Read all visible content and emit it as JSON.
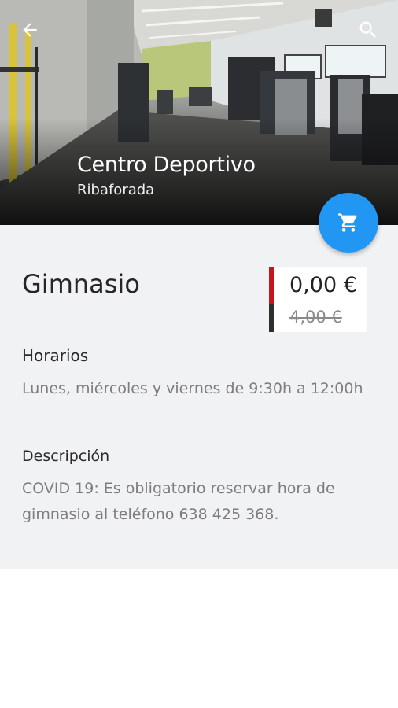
{
  "header": {
    "venue_name": "Centro Deportivo",
    "venue_location": "Ribaforada",
    "back_icon": "arrow-back-icon",
    "search_icon": "search-icon"
  },
  "fab": {
    "icon": "cart-icon",
    "color": "#2196f3"
  },
  "service": {
    "name": "Gimnasio",
    "price_current": "0,00 €",
    "price_original": "4,00 €"
  },
  "horarios": {
    "label": "Horarios",
    "text": "Lunes, miércoles y viernes de 9:30h a 12:00h"
  },
  "descripcion": {
    "label": "Descripción",
    "text": "COVID 19: Es obligatorio reservar hora de gimnasio al teléfono 638 425 368."
  },
  "colors": {
    "accent": "#2196f3",
    "price_bar_top": "#c6161c",
    "price_bar_bottom": "#2e2e2e",
    "content_background": "#f1f2f4"
  }
}
